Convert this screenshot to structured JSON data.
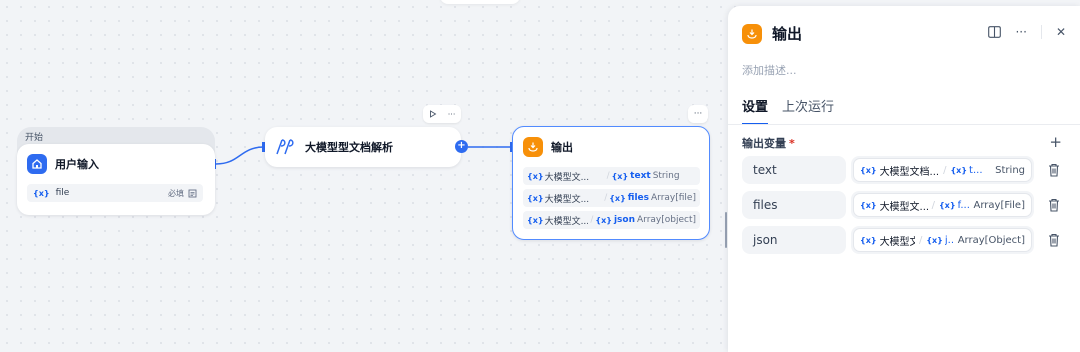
{
  "canvas": {
    "start_group_label": "开始",
    "start_node": {
      "title": "用户输入",
      "variable": {
        "symbol": "{x}",
        "name": "file",
        "required_label": "必填"
      }
    },
    "llm_node": {
      "title": "大模型型文档解析"
    },
    "output_node": {
      "title": "输出",
      "rows": [
        {
          "symbol": "{x}",
          "source": "大模型文...",
          "var_symbol": "{x}",
          "var": "text",
          "type": "String"
        },
        {
          "symbol": "{x}",
          "source": "大模型文...",
          "var_symbol": "{x}",
          "var": "files",
          "type": "Array[file]"
        },
        {
          "symbol": "{x}",
          "source": "大模型文...",
          "var_symbol": "{x}",
          "var": "json",
          "type": "Array[object]"
        }
      ]
    },
    "toolbar": {
      "run_icon": "play-icon",
      "more_label": "···"
    },
    "plus_label": "+"
  },
  "panel": {
    "title": "输出",
    "description_placeholder": "添加描述...",
    "tabs": [
      {
        "label": "设置",
        "active": true
      },
      {
        "label": "上次运行",
        "active": false
      }
    ],
    "section_label": "输出变量",
    "required_mark": "*",
    "add_label": "+",
    "more_label": "···",
    "close_label": "✕",
    "variables": [
      {
        "name": "text",
        "source": "大模型文档...",
        "var": "t...",
        "type": "String"
      },
      {
        "name": "files",
        "source": "大模型文...",
        "var": "f...",
        "type": "Array[File]"
      },
      {
        "name": "json",
        "source": "大模型文...",
        "var": "j...",
        "type": "Array[Object]"
      }
    ]
  },
  "colors": {
    "accent": "#155eef",
    "node_blue": "#2e6bf0",
    "output_orange": "#f79009"
  }
}
